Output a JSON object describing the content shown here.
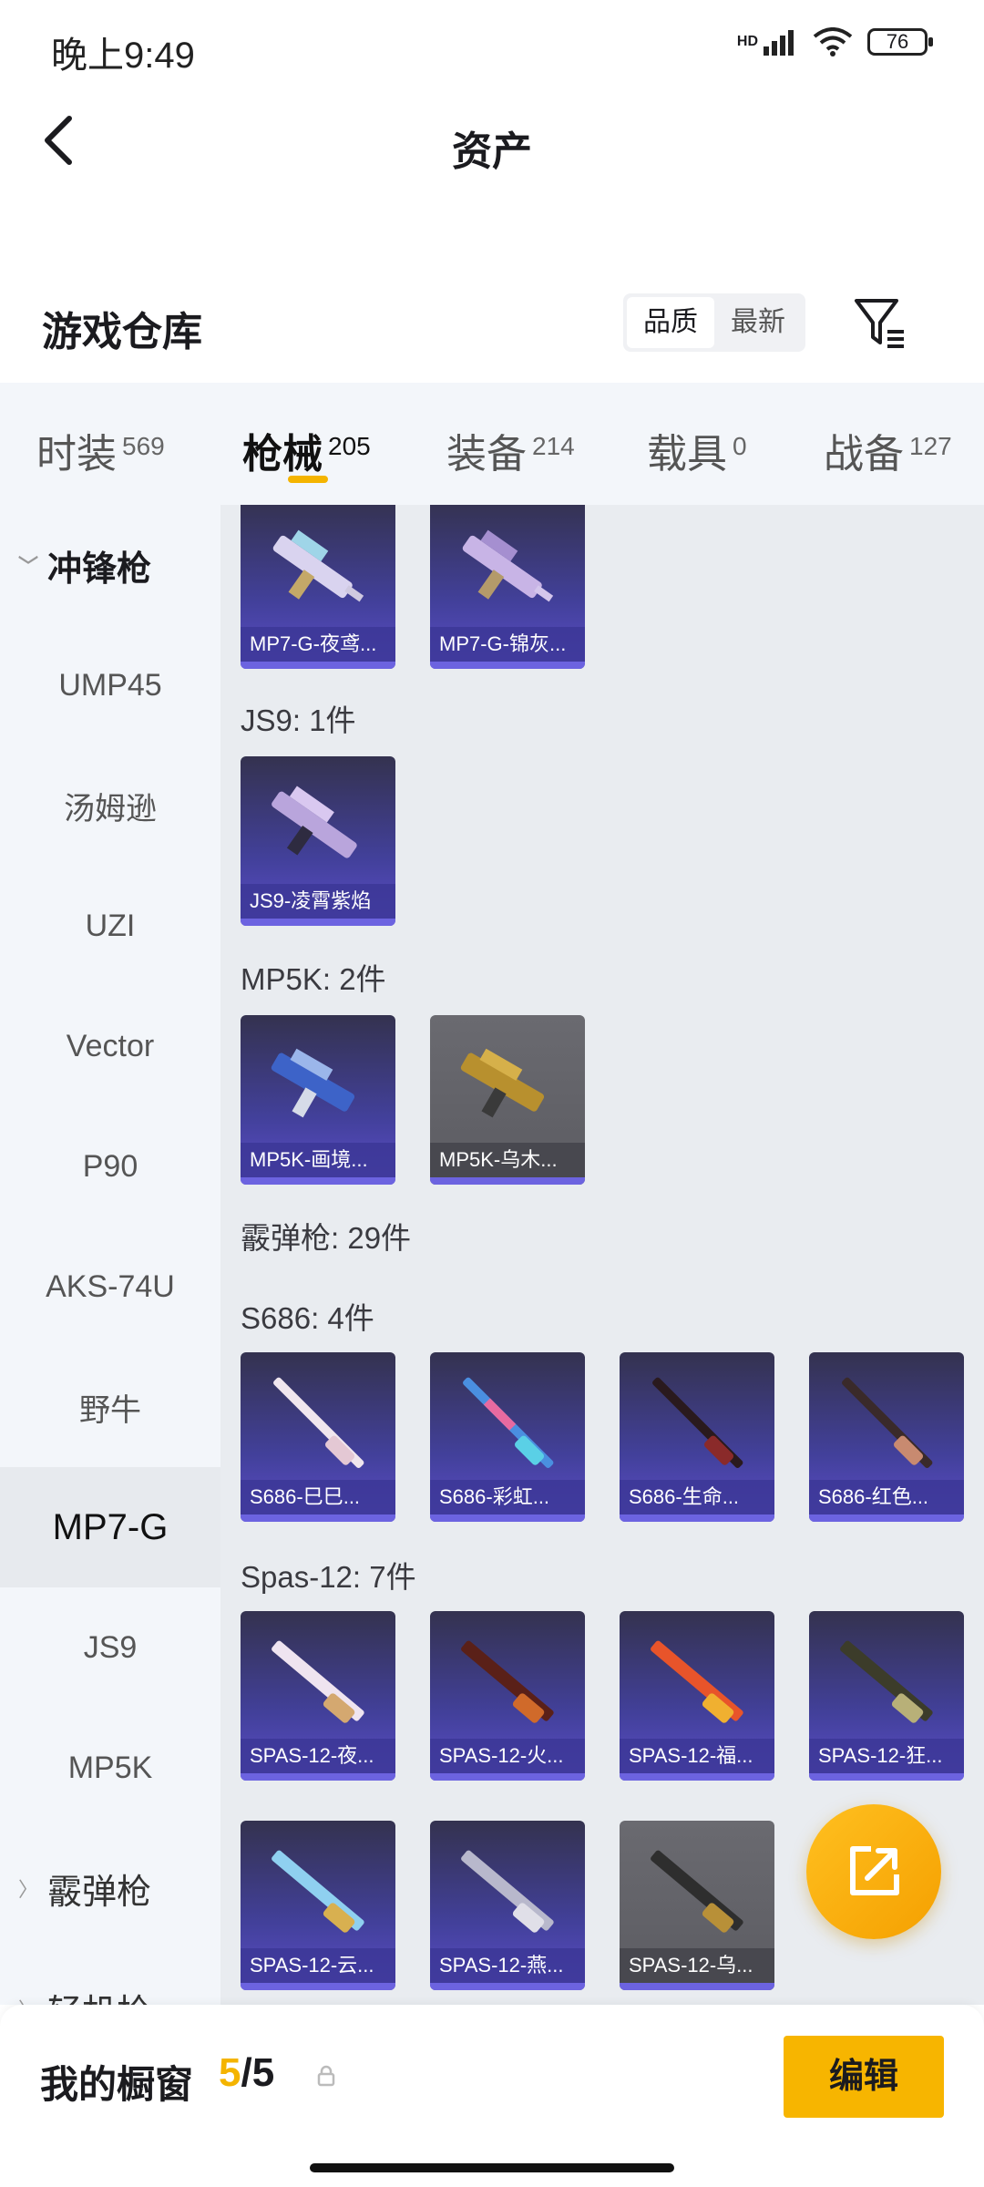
{
  "status_bar": {
    "time": "晚上9:49",
    "network_label": "HD",
    "battery": "76"
  },
  "header": {
    "title": "资产"
  },
  "warehouse": {
    "title": "游戏仓库",
    "sort_options": [
      "品质",
      "最新"
    ],
    "active_sort": "品质"
  },
  "tabs": [
    {
      "label": "时装",
      "count": "569"
    },
    {
      "label": "枪械",
      "count": "205",
      "active": true
    },
    {
      "label": "装备",
      "count": "214"
    },
    {
      "label": "载具",
      "count": "0"
    },
    {
      "label": "战备",
      "count": "127"
    }
  ],
  "sidebar": {
    "items": [
      {
        "label": "冲锋枪",
        "type": "group-expanded"
      },
      {
        "label": "UMP45"
      },
      {
        "label": "汤姆逊"
      },
      {
        "label": "UZI"
      },
      {
        "label": "Vector"
      },
      {
        "label": "P90"
      },
      {
        "label": "AKS-74U"
      },
      {
        "label": "野牛"
      },
      {
        "label": "MP7-G",
        "selected": true
      },
      {
        "label": "JS9"
      },
      {
        "label": "MP5K"
      },
      {
        "label": "霰弹枪",
        "type": "group-collapsed"
      },
      {
        "label": "轻机枪",
        "type": "group-collapsed"
      }
    ]
  },
  "sections": {
    "js9": "JS9: 1件",
    "mp5k": "MP5K: 2件",
    "shotgun": "霰弹枪: 29件",
    "s686": "S686: 4件",
    "spas12": "Spas-12: 7件"
  },
  "cards": {
    "mp7": [
      "MP7-G-夜鸢...",
      "MP7-G-锦灰..."
    ],
    "js9": [
      "JS9-凌霄紫焰"
    ],
    "mp5k": [
      "MP5K-画境...",
      "MP5K-乌木..."
    ],
    "s686": [
      "S686-巳巳...",
      "S686-彩虹...",
      "S686-生命...",
      "S686-红色..."
    ],
    "spas12": [
      "SPAS-12-夜...",
      "SPAS-12-火...",
      "SPAS-12-福...",
      "SPAS-12-狂...",
      "SPAS-12-云...",
      "SPAS-12-燕...",
      "SPAS-12-乌..."
    ]
  },
  "bottom_bar": {
    "title": "我的橱窗",
    "current": "5",
    "total": "/5",
    "edit_label": "编辑"
  }
}
